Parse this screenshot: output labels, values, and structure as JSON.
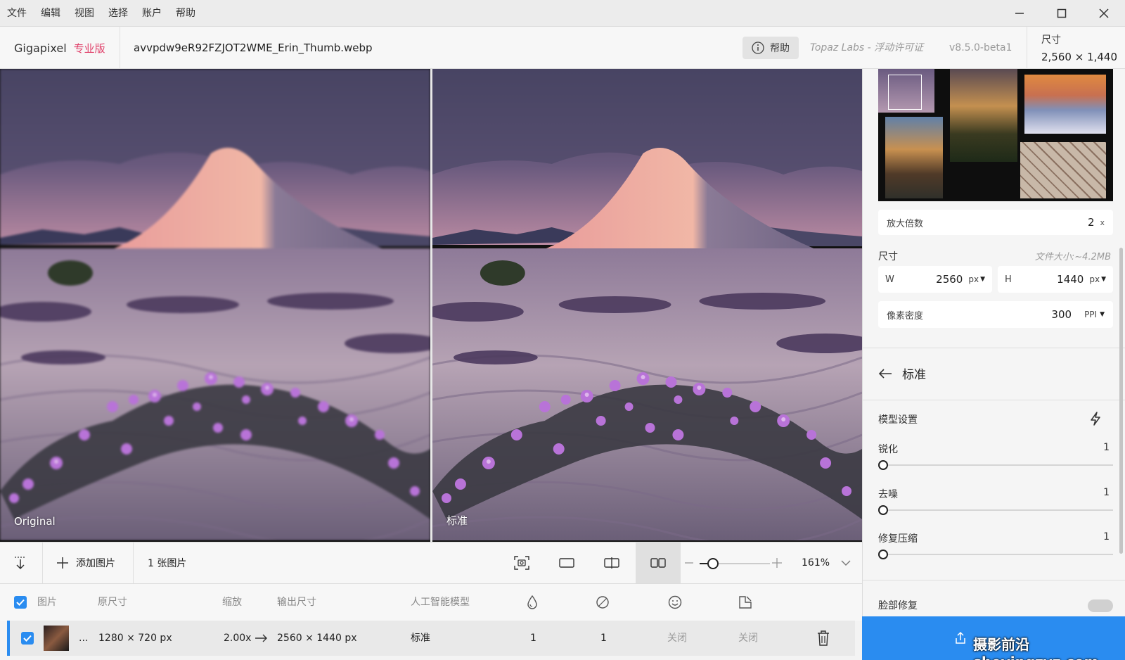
{
  "menu": [
    "文件",
    "编辑",
    "视图",
    "选择",
    "账户",
    "帮助"
  ],
  "header": {
    "brand": "Gigapixel",
    "edition": "专业版",
    "filename": "avvpdw9eR92FZJOT2WME_Erin_Thumb.webp",
    "help_label": "帮助",
    "license": "Topaz Labs - 浮动许可证",
    "version": "v8.5.0-beta1",
    "size_label": "尺寸",
    "size_value": "2,560 × 1,440"
  },
  "preview": {
    "left_label": "Original",
    "right_label": "标准"
  },
  "sidebar": {
    "scale_label": "放大倍数",
    "scale_value": "2",
    "scale_unit": "x",
    "dimensions_label": "尺寸",
    "file_size": "文件大小:~4.2MB",
    "width_label": "W",
    "width_value": "2560",
    "width_unit": "px",
    "height_label": "H",
    "height_value": "1440",
    "height_unit": "px",
    "ppi_label": "像素密度",
    "ppi_value": "300",
    "ppi_unit": "PPI",
    "model_name": "标准",
    "model_settings_label": "模型设置",
    "sliders": [
      {
        "label": "锐化",
        "value": "1"
      },
      {
        "label": "去噪",
        "value": "1"
      },
      {
        "label": "修复压缩",
        "value": "1"
      }
    ],
    "cut_label": "脸部修复"
  },
  "toolbar": {
    "add_label": "添加图片",
    "count_label": "1 张图片",
    "zoom_value": "161%"
  },
  "table": {
    "headers": [
      "图片",
      "原尺寸",
      "缩放",
      "输出尺寸",
      "人工智能模型"
    ],
    "row": {
      "ellipsis": "...",
      "original_size": "1280 × 720 px",
      "scale": "2.00x",
      "output_size": "2560 × 1440 px",
      "model": "标准",
      "sharpen": "1",
      "denoise": "1",
      "face": "关闭",
      "color": "关闭"
    }
  },
  "watermark": "摄影前沿 sheyingzyz.com",
  "colors": {
    "accent": "#2a8cf0",
    "brand_pink": "#e0406a"
  }
}
